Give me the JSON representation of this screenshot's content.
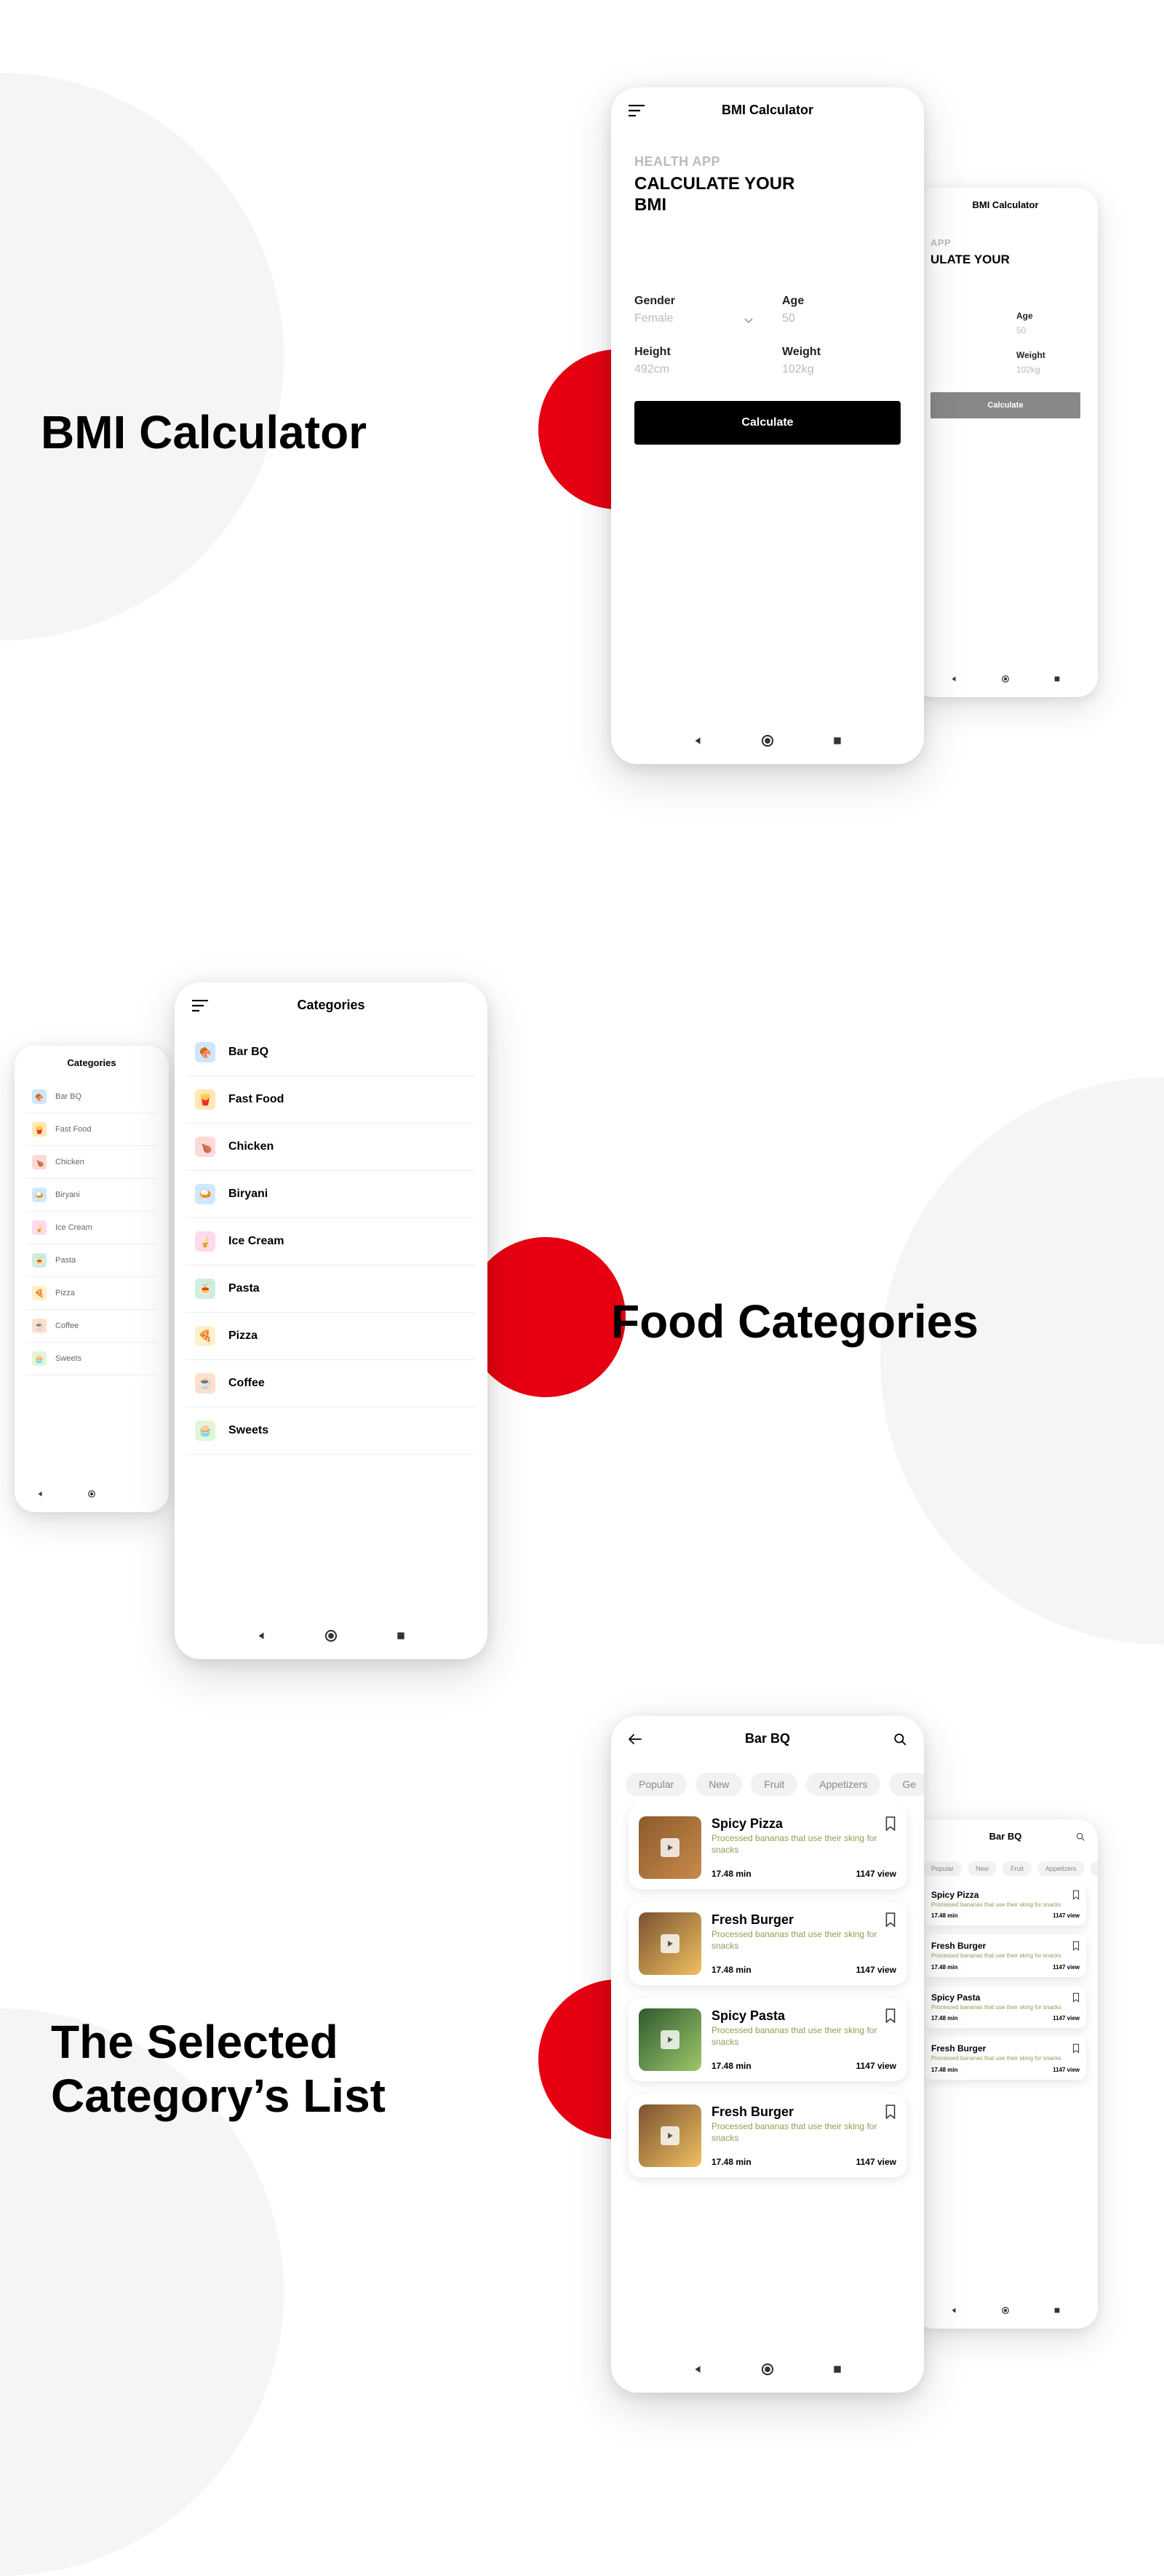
{
  "section_titles": {
    "bmi": "BMI Calculator",
    "categories": "Food Categories",
    "list": "The Selected\nCategory's List"
  },
  "bmi_screen": {
    "title": "BMI Calculator",
    "subtitle": "HEALTH APP",
    "heading": "CALCULATE YOUR BMI",
    "fields": {
      "gender": {
        "label": "Gender",
        "value": "Female"
      },
      "age": {
        "label": "Age",
        "value": "50"
      },
      "height": {
        "label": "Height",
        "value": "492cm"
      },
      "weight": {
        "label": "Weight",
        "value": "102kg"
      }
    },
    "button": "Calculate"
  },
  "categories_screen": {
    "title": "Categories",
    "items": [
      {
        "name": "Bar BQ",
        "color": "#cfe6ff",
        "emoji": "🍖"
      },
      {
        "name": "Fast Food",
        "color": "#ffe8b3",
        "emoji": "🍟"
      },
      {
        "name": "Chicken",
        "color": "#ffd9d9",
        "emoji": "🍗"
      },
      {
        "name": "Biryani",
        "color": "#cfe8ff",
        "emoji": "🍛"
      },
      {
        "name": "Ice Cream",
        "color": "#ffd9ec",
        "emoji": "🍦"
      },
      {
        "name": "Pasta",
        "color": "#cfeee0",
        "emoji": "🍝"
      },
      {
        "name": "Pizza",
        "color": "#fff0cc",
        "emoji": "🍕"
      },
      {
        "name": "Coffee",
        "color": "#ffe0cc",
        "emoji": "☕"
      },
      {
        "name": "Sweets",
        "color": "#e0f7d6",
        "emoji": "🧁"
      }
    ]
  },
  "list_screen": {
    "title": "Bar BQ",
    "chips": [
      "Popular",
      "New",
      "Fruit",
      "Appetizers",
      "Ge"
    ],
    "items": [
      {
        "title": "Spicy Pizza",
        "desc": "Processed bananas that use their sking for snacks",
        "time": "17.48 min",
        "views": "1147 view",
        "img": "pizza"
      },
      {
        "title": "Fresh Burger",
        "desc": "Processed bananas that use their sking for snacks",
        "time": "17.48 min",
        "views": "1147 view",
        "img": "burger"
      },
      {
        "title": "Spicy Pasta",
        "desc": "Processed bananas that use their sking for snacks",
        "time": "17.48 min",
        "views": "1147 view",
        "img": "pasta"
      },
      {
        "title": "Fresh Burger",
        "desc": "Processed bananas that use their sking for snacks",
        "time": "17.48 min",
        "views": "1147 view",
        "img": "burger"
      }
    ]
  }
}
